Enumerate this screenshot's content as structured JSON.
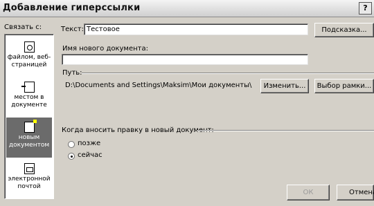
{
  "window": {
    "title": "Добавление гиперссылки",
    "help_label": "?"
  },
  "link_to": {
    "label": "Связать с:",
    "items": [
      {
        "label": "файлом, веб-страницей",
        "icon": "web-page-icon",
        "active": false
      },
      {
        "label": "местом в документе",
        "icon": "document-place-icon",
        "active": false
      },
      {
        "label": "новым документом",
        "icon": "new-document-icon",
        "active": true
      },
      {
        "label": "электронной почтой",
        "icon": "email-icon",
        "active": false
      }
    ]
  },
  "text_field": {
    "label": "Текст:",
    "value": "Тестовое"
  },
  "tooltip_button": {
    "label": "Подсказка..."
  },
  "new_doc_name": {
    "label": "Имя нового документа:",
    "value": ""
  },
  "path": {
    "label": "Путь:",
    "value": "D:\\Documents and Settings\\Maksim\\Мои документы\\"
  },
  "change_button": {
    "label": "Изменить..."
  },
  "frame_button": {
    "label": "Выбор рамки..."
  },
  "edit_when": {
    "label": "Когда вносить правку в новый документ:",
    "options": [
      {
        "label": "позже",
        "selected": false
      },
      {
        "label": "сейчас",
        "selected": true
      }
    ]
  },
  "ok_button": {
    "label": "ОК"
  },
  "cancel_button": {
    "label": "Отмена"
  }
}
